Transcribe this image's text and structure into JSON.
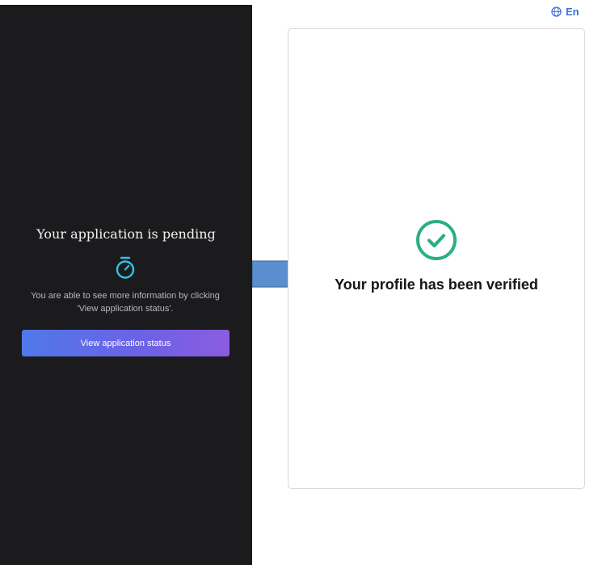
{
  "left_panel": {
    "title": "Your application is pending",
    "description_line1": "You are able to see more information by clicking",
    "description_line2": "'View application status'.",
    "button_label": "View application status",
    "icon": "stopwatch-icon",
    "icon_color": "#33c3e8",
    "background_color": "#1b1b1d"
  },
  "arrow": {
    "icon": "right-arrow-icon",
    "color": "#5b8ecf"
  },
  "language": {
    "label": "En",
    "icon": "globe-icon",
    "color": "#3b6fd8"
  },
  "right_panel": {
    "title": "Your profile has been verified",
    "icon": "check-circle-icon",
    "icon_color": "#2ab07f"
  }
}
